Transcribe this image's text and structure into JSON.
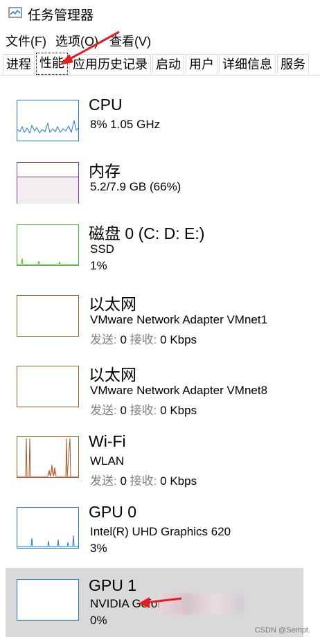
{
  "window": {
    "title": "任务管理器",
    "icon": "task-manager-icon"
  },
  "menu": [
    {
      "label": "文件(F)"
    },
    {
      "label": "选项(O)"
    },
    {
      "label": "查看(V)"
    }
  ],
  "tabs": [
    {
      "label": "进程"
    },
    {
      "label": "性能"
    },
    {
      "label": "应用历史记录"
    },
    {
      "label": "启动"
    },
    {
      "label": "用户"
    },
    {
      "label": "详细信息"
    },
    {
      "label": "服务"
    }
  ],
  "active_tab": "性能",
  "items": [
    {
      "name": "CPU",
      "line1": "8% 1.05 GHz",
      "color": "#1e78c8"
    },
    {
      "name": "内存",
      "line1": "5.2/7.9 GB (66%)",
      "color": "#8b3a8b"
    },
    {
      "name": "磁盘 0 (C: D: E:)",
      "line1": "SSD",
      "line2": "1%",
      "color": "#4caf28"
    },
    {
      "name": "以太网",
      "line1": "VMware Network Adapter VMnet1",
      "send_label": "发送:",
      "send_value": "0",
      "recv_label": "接收:",
      "recv_value": "0 Kbps",
      "color": "#a05a28"
    },
    {
      "name": "以太网",
      "line1": "VMware Network Adapter VMnet8",
      "send_label": "发送:",
      "send_value": "0",
      "recv_label": "接收:",
      "recv_value": "0 Kbps",
      "color": "#a05a28"
    },
    {
      "name": "Wi-Fi",
      "line1": "WLAN",
      "send_label": "发送:",
      "send_value": "0",
      "recv_label": "接收:",
      "recv_value": "0 Kbps",
      "color": "#a05a28"
    },
    {
      "name": "GPU 0",
      "line1": "Intel(R) UHD Graphics 620",
      "line2": "3%",
      "color": "#1e78c8"
    },
    {
      "name": "GPU 1",
      "line1": "NVIDIA Geforce",
      "line2": "0%",
      "color": "#1e78c8"
    }
  ],
  "watermark": "CSDN @Sempt."
}
